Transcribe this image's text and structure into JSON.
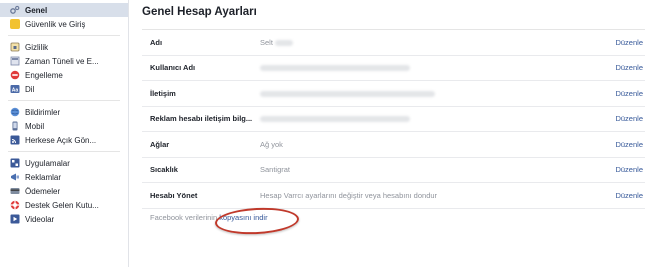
{
  "sidebar": {
    "groups": [
      {
        "items": [
          {
            "label": "Genel",
            "icon": "gear-icon",
            "active": true
          },
          {
            "label": "Güvenlik ve Giriş",
            "icon": "shield-icon"
          }
        ]
      },
      {
        "items": [
          {
            "label": "Gizlilik",
            "icon": "lock-icon"
          },
          {
            "label": "Zaman Tüneli ve E...",
            "icon": "timeline-icon"
          },
          {
            "label": "Engelleme",
            "icon": "block-icon"
          },
          {
            "label": "Dil",
            "icon": "language-icon"
          }
        ]
      },
      {
        "items": [
          {
            "label": "Bildirimler",
            "icon": "globe-icon"
          },
          {
            "label": "Mobil",
            "icon": "mobile-icon"
          },
          {
            "label": "Herkese Açık Gön...",
            "icon": "rss-icon"
          }
        ]
      },
      {
        "items": [
          {
            "label": "Uygulamalar",
            "icon": "apps-icon"
          },
          {
            "label": "Reklamlar",
            "icon": "ads-icon"
          },
          {
            "label": "Ödemeler",
            "icon": "payments-icon"
          },
          {
            "label": "Destek Gelen Kutu...",
            "icon": "support-icon"
          },
          {
            "label": "Videolar",
            "icon": "video-icon"
          }
        ]
      }
    ]
  },
  "main": {
    "title": "Genel Hesap Ayarları",
    "rows": [
      {
        "label": "Adı",
        "value": "Selt",
        "edit": "Düzenle"
      },
      {
        "label": "Kullanıcı Adı",
        "value": "",
        "edit": "Düzenle"
      },
      {
        "label": "İletişim",
        "value": "",
        "edit": "Düzenle"
      },
      {
        "label": "Reklam hesabı iletişim bilg...",
        "value": "",
        "edit": "Düzenle"
      },
      {
        "label": "Ağlar",
        "value": "Ağ yok",
        "edit": "Düzenle"
      },
      {
        "label": "Sıcaklık",
        "value": "Santigrat",
        "edit": "Düzenle"
      },
      {
        "label": "Hesabı Yönet",
        "value": "Hesap Varrcı ayarlarını değiştir veya hesabını dondur",
        "edit": "Düzenle"
      }
    ],
    "footer": {
      "prefix": "Facebook verilerinin",
      "link": "kopyasını indir"
    }
  },
  "colors": {
    "link": "#365899",
    "active_bg": "#d8dfea",
    "highlight_ring": "#c0392b"
  }
}
